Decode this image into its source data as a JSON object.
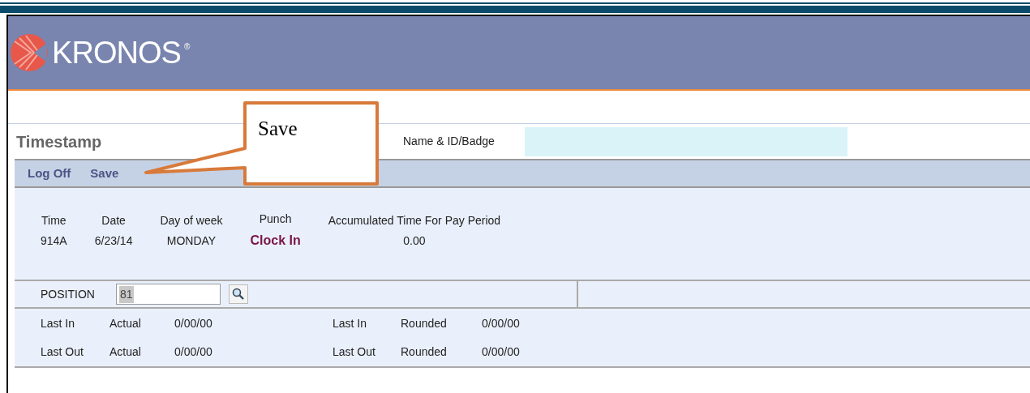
{
  "logo": {
    "text": "KRONOS",
    "mark": "®"
  },
  "page_title": "Timestamp",
  "name_label": "Name & ID/Badge",
  "menu": [
    "Log Off",
    "Save"
  ],
  "summary": [
    {
      "label": "Time",
      "value": "914A",
      "kind": "plain"
    },
    {
      "label": "Date",
      "value": "6/23/14",
      "kind": "plain"
    },
    {
      "label": "Day of week",
      "value": "MONDAY",
      "kind": "plain"
    },
    {
      "label": "Punch",
      "value": "Clock In",
      "kind": "punch"
    },
    {
      "label": "Accumulated Time For Pay Period",
      "value": "0.00",
      "kind": "plain"
    }
  ],
  "position": {
    "label": "POSITION",
    "value": "81",
    "highlighted": true
  },
  "last_punches": [
    {
      "left": [
        "Last In",
        "Actual",
        "0/00/00"
      ],
      "right": [
        "Last In",
        "Rounded",
        "0/00/00"
      ]
    },
    {
      "left": [
        "Last Out",
        "Actual",
        "0/00/00"
      ],
      "right": [
        "Last Out",
        "Rounded",
        "0/00/00"
      ]
    }
  ],
  "callout": {
    "text": "Save"
  }
}
